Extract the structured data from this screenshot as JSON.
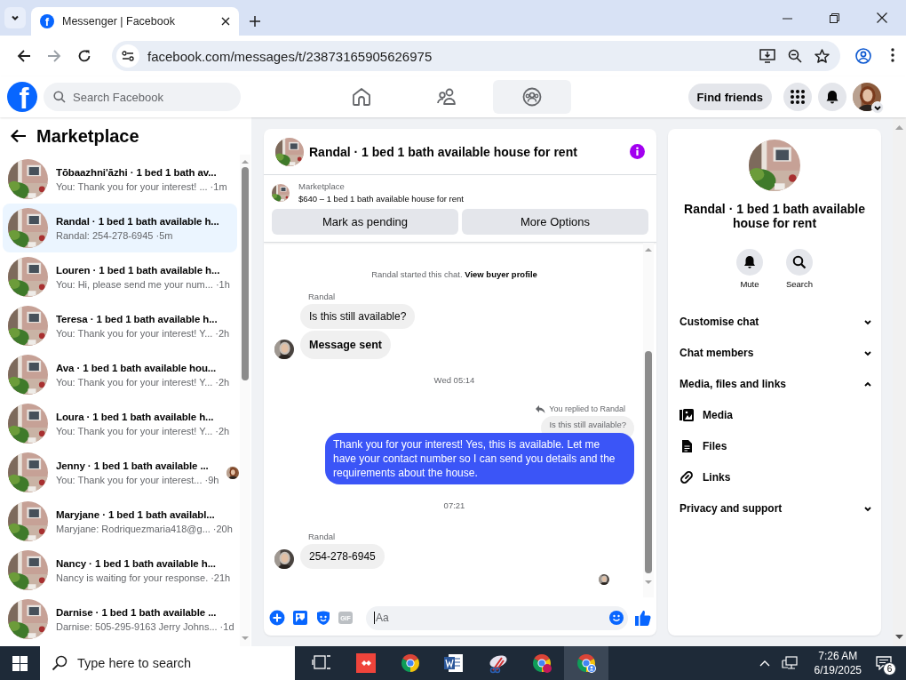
{
  "browser": {
    "favicon": "f",
    "tab_title": "Messenger | Facebook",
    "url": "facebook.com/messages/t/23873165905626975"
  },
  "header": {
    "logo": "f",
    "search_placeholder": "Search Facebook",
    "nav": [
      {
        "kind": "home",
        "selected": false
      },
      {
        "kind": "friends",
        "selected": false
      },
      {
        "kind": "groups",
        "selected": true
      }
    ],
    "find_friends": "Find friends"
  },
  "sidebar": {
    "title": "Marketplace",
    "conversations": [
      {
        "title": "Tōbaazhni'āzhi · 1 bed 1 bath av...",
        "preview": "You: Thank you for your interest! ...",
        "time": "·1m",
        "selected": false,
        "seen": false
      },
      {
        "title": "Randal · 1 bed 1 bath available h...",
        "preview": "Randal: 254-278-6945",
        "time": "·5m",
        "selected": true,
        "seen": false
      },
      {
        "title": "Louren · 1 bed 1 bath available h...",
        "preview": "You: Hi, please send me your num...",
        "time": "·1h",
        "selected": false,
        "seen": false
      },
      {
        "title": "Teresa · 1 bed 1 bath available h...",
        "preview": "You: Thank you for your interest! Y...",
        "time": "·2h",
        "selected": false,
        "seen": false
      },
      {
        "title": "Ava · 1 bed 1 bath available hou...",
        "preview": "You: Thank you for your interest! Y...",
        "time": "·2h",
        "selected": false,
        "seen": false
      },
      {
        "title": "Loura · 1 bed 1 bath available h...",
        "preview": "You: Thank you for your interest! Y...",
        "time": "·2h",
        "selected": false,
        "seen": false
      },
      {
        "title": "Jenny · 1 bed 1 bath available ...",
        "preview": "You: Thank you for your interest...",
        "time": "·9h",
        "selected": false,
        "seen": true
      },
      {
        "title": "Maryjane · 1 bed 1 bath availabl...",
        "preview": "Maryjane: Rodriquezmaria418@g...",
        "time": "·20h",
        "selected": false,
        "seen": false
      },
      {
        "title": "Nancy · 1 bed 1 bath available h...",
        "preview": "Nancy is waiting for your response.",
        "time": "·21h",
        "selected": false,
        "seen": false
      },
      {
        "title": "Darnise · 1 bed 1 bath available ...",
        "preview": "Darnise: 505-295-9163 Jerry Johns...",
        "time": "·1d",
        "selected": false,
        "seen": false
      }
    ]
  },
  "chat": {
    "title": "Randal · 1 bed 1 bath available house for rent",
    "listing": {
      "label": "Marketplace",
      "text": "$640 – 1 bed 1 bath available house for rent"
    },
    "buttons": [
      "Mark as pending",
      "More Options"
    ],
    "messages": [
      {
        "kind": "notice",
        "text": "Randal started this chat.",
        "link": "View buyer profile"
      },
      {
        "kind": "incoming",
        "sender": "Randal",
        "bubbles": [
          "Is this still available?",
          "Message sent"
        ]
      },
      {
        "kind": "time",
        "text": "Wed 05:14"
      },
      {
        "kind": "outgoing",
        "reply_label": "You replied to Randal",
        "quoted": "Is this still available?",
        "text": "Thank you for your interest! Yes, this is available. Let me have your contact number so I can send you details and the requirements about the house."
      },
      {
        "kind": "time",
        "text": "07:21"
      },
      {
        "kind": "incoming",
        "sender": "Randal",
        "bubbles": [
          "254-278-6945"
        ]
      },
      {
        "kind": "seen"
      }
    ],
    "composer": {
      "gif": "GIF",
      "placeholder": "Aa"
    }
  },
  "info": {
    "title": "Randal · 1 bed 1 bath available house for rent",
    "actions": [
      {
        "kind": "bell",
        "label": "Mute"
      },
      {
        "kind": "search",
        "label": "Search"
      }
    ],
    "sections": [
      {
        "label": "Customise chat",
        "expanded": false
      },
      {
        "label": "Chat members",
        "expanded": false
      },
      {
        "label": "Media, files and links",
        "expanded": true,
        "children": [
          {
            "kind": "media",
            "label": "Media"
          },
          {
            "kind": "file",
            "label": "Files"
          },
          {
            "kind": "link",
            "label": "Links"
          }
        ]
      },
      {
        "label": "Privacy and support",
        "expanded": false
      }
    ]
  },
  "taskbar": {
    "search_placeholder": "Type here to search",
    "apps": [
      {
        "kind": "task-view",
        "selected": false
      },
      {
        "kind": "remote",
        "selected": false
      },
      {
        "kind": "chrome",
        "selected": false
      },
      {
        "kind": "word",
        "selected": false
      },
      {
        "kind": "snip",
        "selected": false
      },
      {
        "kind": "chrome-badge",
        "selected": false
      },
      {
        "kind": "chrome-profile",
        "selected": true
      }
    ],
    "time": "7:26 AM",
    "date": "6/19/2025",
    "notifications": "6"
  }
}
